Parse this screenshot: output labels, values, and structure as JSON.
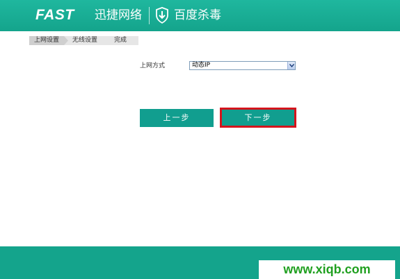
{
  "header": {
    "brand_logo": "FAST",
    "brand_cn": "迅捷网络",
    "partner_text": "百度杀毒",
    "partner_icon": "shield-download-icon"
  },
  "steps": [
    "上网设置",
    "无线设置",
    "完成"
  ],
  "form": {
    "label": "上网方式",
    "select_value": "动态IP"
  },
  "buttons": {
    "prev": "上一步",
    "next": "下一步"
  },
  "watermark": "www.xiqb.com",
  "colors": {
    "brand": "#14a48c",
    "button": "#119e8f",
    "highlight": "#d4141c"
  }
}
